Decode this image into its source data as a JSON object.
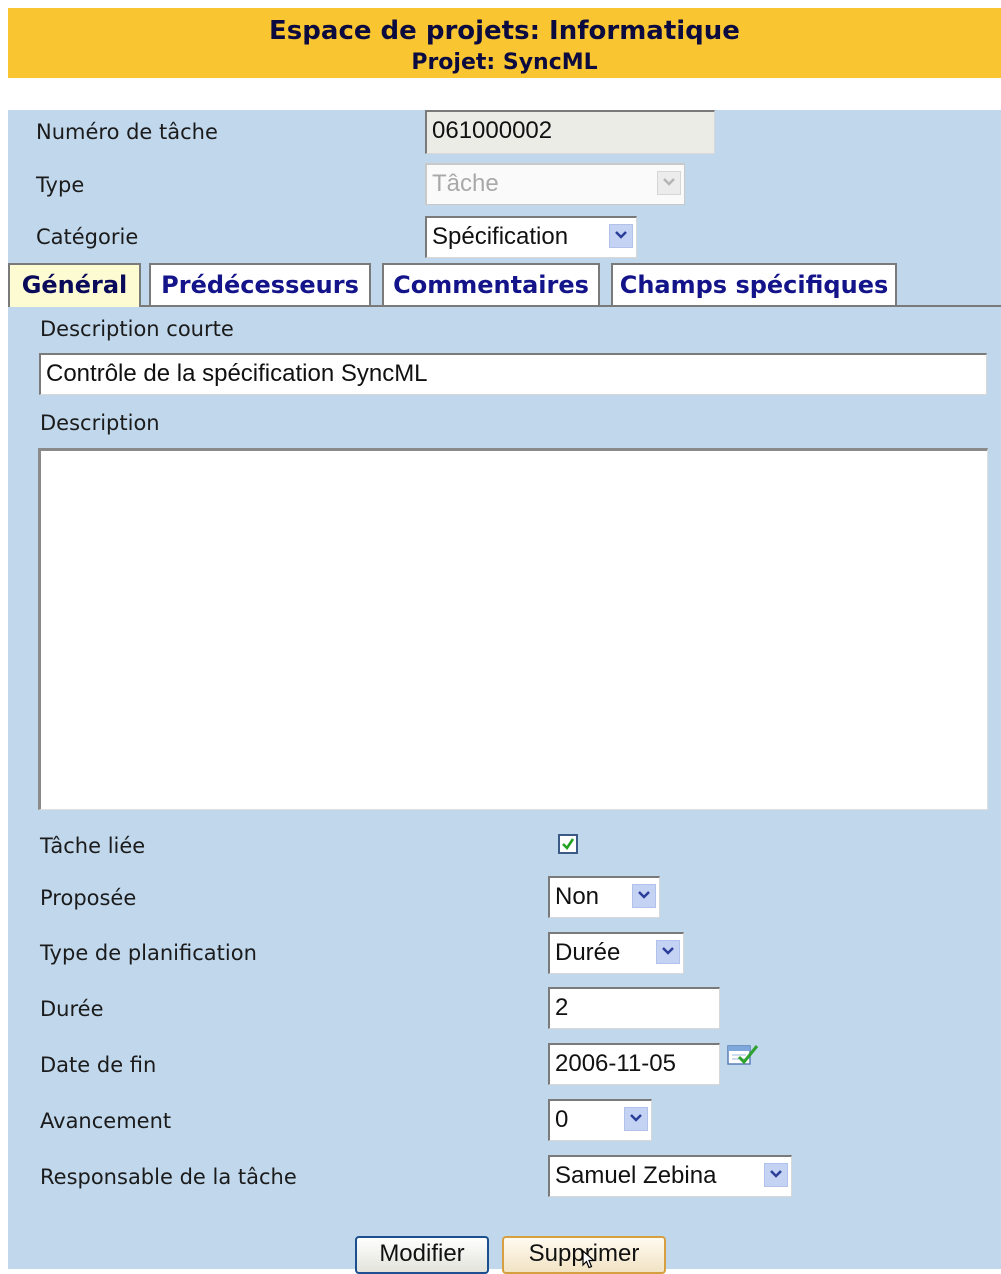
{
  "header": {
    "space_title": "Espace de projets: Informatique",
    "project_title": "Projet: SyncML"
  },
  "top_fields": {
    "task_number": {
      "label": "Numéro de tâche",
      "value": "061000002"
    },
    "type": {
      "label": "Type",
      "value": "Tâche"
    },
    "category": {
      "label": "Catégorie",
      "value": "Spécification"
    }
  },
  "tabs": [
    {
      "label": "Général",
      "active": true
    },
    {
      "label": "Prédécesseurs",
      "active": false
    },
    {
      "label": "Commentaires",
      "active": false
    },
    {
      "label": "Champs spécifiques",
      "active": false
    }
  ],
  "general": {
    "short_description": {
      "label": "Description courte",
      "value": "Contrôle de la spécification SyncML"
    },
    "description": {
      "label": "Description",
      "value": ""
    },
    "linked_task": {
      "label": "Tâche liée",
      "checked": true
    },
    "proposed": {
      "label": "Proposée",
      "value": "Non"
    },
    "planning_type": {
      "label": "Type de planification",
      "value": "Durée"
    },
    "duration": {
      "label": "Durée",
      "value": "2"
    },
    "end_date": {
      "label": "Date de fin",
      "value": "2006-11-05"
    },
    "progress": {
      "label": "Avancement",
      "value": "0"
    },
    "owner": {
      "label": "Responsable de la tâche",
      "value": "Samuel Zebina"
    }
  },
  "buttons": {
    "modify": "Modifier",
    "delete": "Supprimer"
  },
  "colors": {
    "header_bg": "#f9c631",
    "panel_bg": "#c0d7ec",
    "tab_text": "#13138a",
    "active_tab_bg": "#fdfbd2"
  }
}
